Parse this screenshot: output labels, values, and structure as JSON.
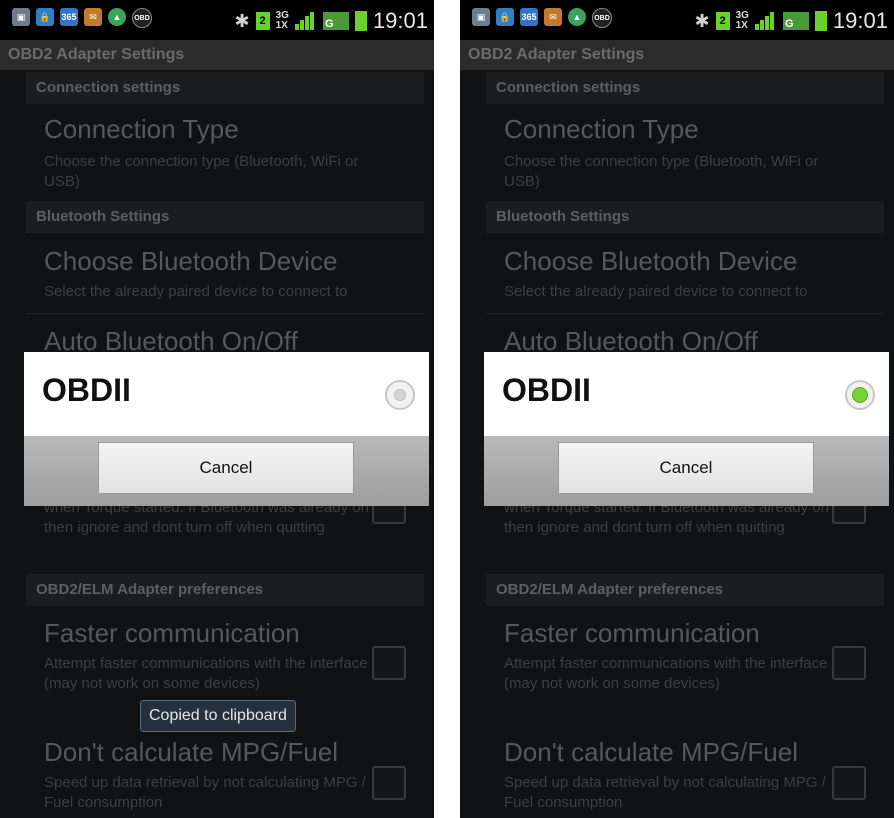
{
  "status_bar": {
    "time": "19:01",
    "net_top": "3G",
    "net_bottom": "1X",
    "sim_slot": "2",
    "sim_net_top": "3G",
    "g_label": "G",
    "app_icon_label": "365",
    "obd_icon_label": "OBD"
  },
  "app_title": "OBD2 Adapter Settings",
  "sections": {
    "connection": "Connection settings",
    "bluetooth": "Bluetooth Settings",
    "adapter": "OBD2/ELM Adapter preferences"
  },
  "prefs": {
    "connection_type": {
      "title": "Connection Type",
      "summary": "Choose the connection type (Bluetooth, WiFi or USB)"
    },
    "choose_device": {
      "title": "Choose Bluetooth Device",
      "summary": "Select the already paired device to connect to"
    },
    "auto_bt": {
      "title": "Auto Bluetooth On/Off",
      "summary_visible": "when Torque started. If Bluetooth was already on then ignore and dont turn off when quitting"
    },
    "faster": {
      "title": "Faster communication",
      "summary": "Attempt faster communications with the interface (may not work on some devices)"
    },
    "mpg": {
      "title": "Don't calculate MPG/Fuel",
      "summary": "Speed up data retrieval by not calculating MPG / Fuel consumption"
    }
  },
  "dialog": {
    "option_label": "OBDII",
    "cancel_label": "Cancel"
  },
  "screens": [
    {
      "radio_selected": false,
      "toast": "Copied to clipboard"
    },
    {
      "radio_selected": true
    }
  ],
  "colors": {
    "accent_green": "#7ad13a"
  }
}
